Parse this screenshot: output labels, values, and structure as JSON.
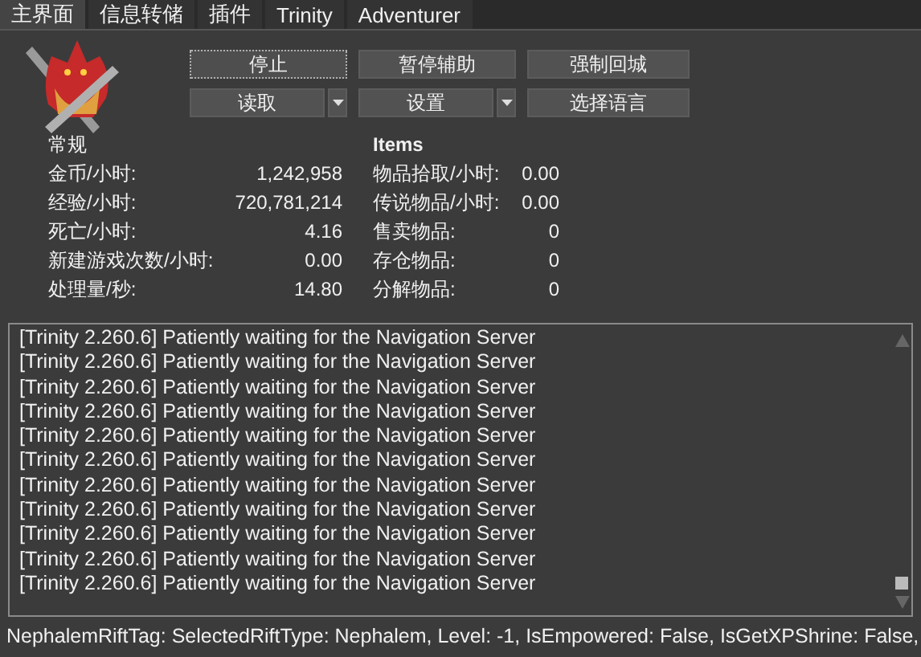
{
  "tabs": [
    {
      "label": "主界面",
      "selected": true
    },
    {
      "label": "信息转储",
      "selected": false
    },
    {
      "label": "插件",
      "selected": false
    },
    {
      "label": "Trinity",
      "selected": false
    },
    {
      "label": "Adventurer",
      "selected": false
    }
  ],
  "buttons": [
    {
      "label": "停止",
      "kind": "plain",
      "focused": true
    },
    {
      "label": "暂停辅助",
      "kind": "plain",
      "focused": false
    },
    {
      "label": "强制回城",
      "kind": "plain",
      "focused": false
    },
    {
      "label": "读取",
      "kind": "split",
      "focused": false
    },
    {
      "label": "设置",
      "kind": "split",
      "focused": false
    },
    {
      "label": "选择语言",
      "kind": "plain",
      "focused": false
    }
  ],
  "general": {
    "heading": "常规",
    "rows": [
      {
        "label": "金币/小时:",
        "value": "1,242,958"
      },
      {
        "label": "经验/小时:",
        "value": "720,781,214"
      },
      {
        "label": "死亡/小时:",
        "value": "4.16"
      },
      {
        "label": "新建游戏次数/小时:",
        "value": "0.00"
      },
      {
        "label": "处理量/秒:",
        "value": "14.80"
      }
    ]
  },
  "items": {
    "heading": "Items",
    "rows": [
      {
        "label": "物品拾取/小时:",
        "value": "0.00"
      },
      {
        "label": "传说物品/小时:",
        "value": "0.00"
      },
      {
        "label": "售卖物品:",
        "value": "0"
      },
      {
        "label": "存仓物品:",
        "value": "0"
      },
      {
        "label": "分解物品:",
        "value": "0"
      }
    ]
  },
  "log": [
    "[Trinity 2.260.6] Patiently waiting for the Navigation Server",
    "[Trinity 2.260.6] Patiently waiting for the Navigation Server",
    "[Trinity 2.260.6] Patiently waiting for the Navigation Server",
    "[Trinity 2.260.6] Patiently waiting for the Navigation Server",
    "[Trinity 2.260.6] Patiently waiting for the Navigation Server",
    "[Trinity 2.260.6] Patiently waiting for the Navigation Server",
    "[Trinity 2.260.6] Patiently waiting for the Navigation Server",
    "[Trinity 2.260.6] Patiently waiting for the Navigation Server",
    "[Trinity 2.260.6] Patiently waiting for the Navigation Server",
    "[Trinity 2.260.6] Patiently waiting for the Navigation Server",
    "[Trinity 2.260.6] Patiently waiting for the Navigation Server"
  ],
  "status_bar": "NephalemRiftTag: SelectedRiftType: Nephalem, Level: -1, IsEmpowered: False, IsGetXPShrine: False,"
}
